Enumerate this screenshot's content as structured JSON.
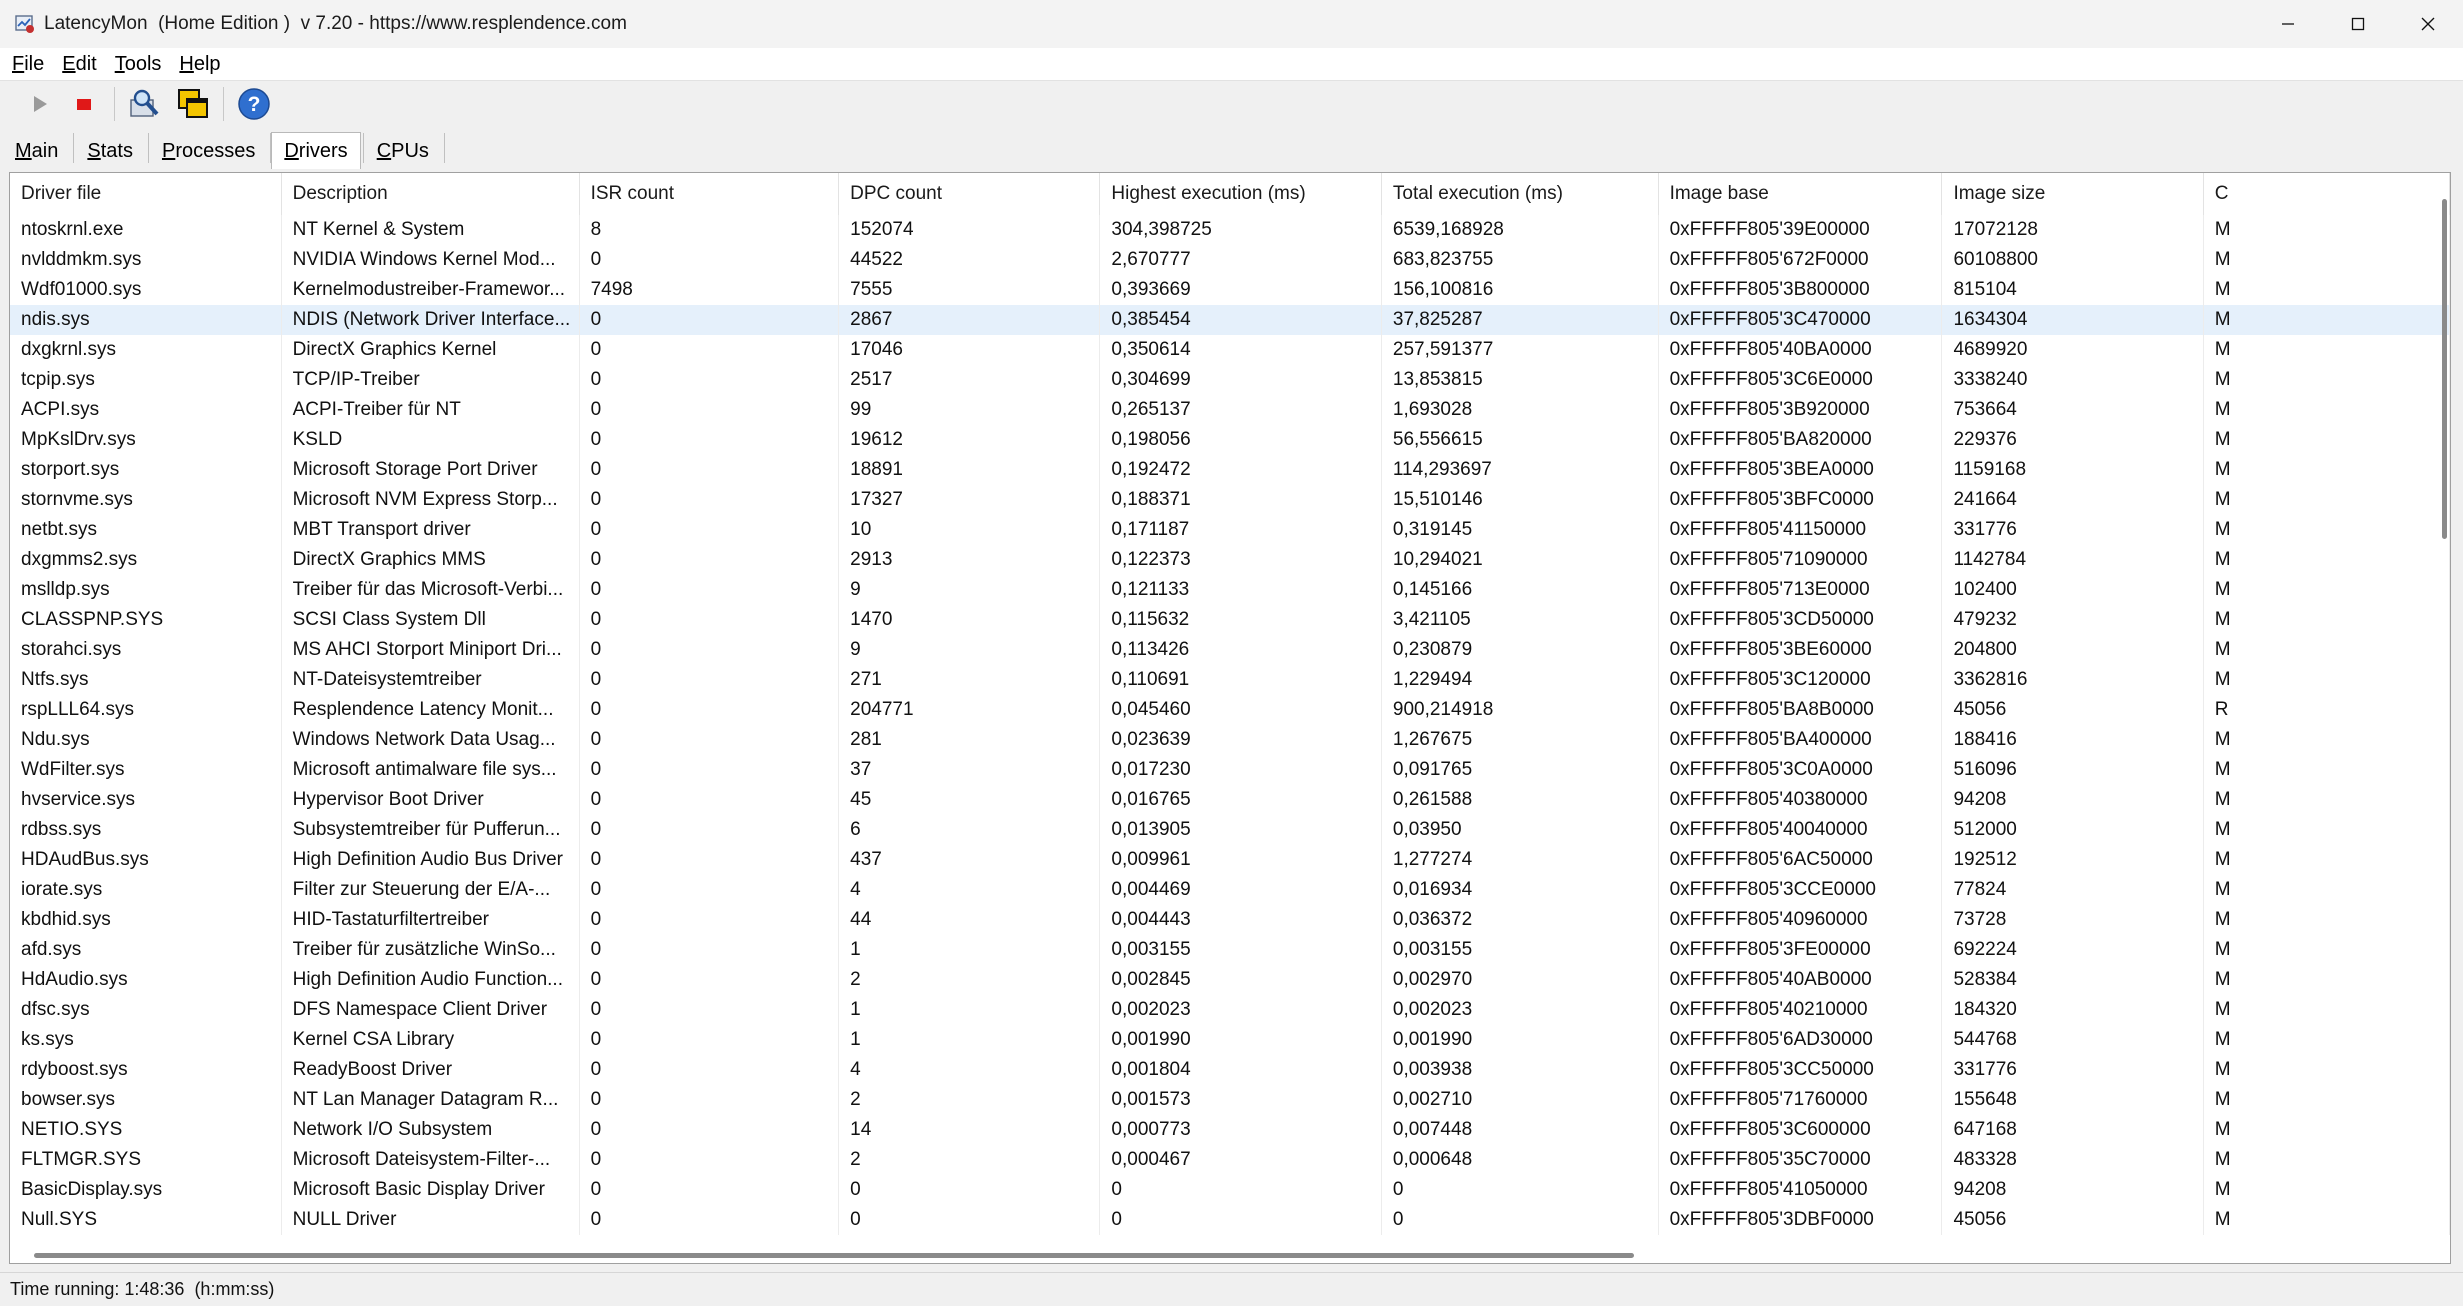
{
  "window": {
    "title": "LatencyMon  (Home Edition )  v 7.20 - https://www.resplendence.com"
  },
  "menu": [
    {
      "key": "F",
      "rest": "ile"
    },
    {
      "key": "E",
      "rest": "dit"
    },
    {
      "key": "T",
      "rest": "ools"
    },
    {
      "key": "H",
      "rest": "elp"
    }
  ],
  "toolbar": {
    "icons": [
      "play-icon",
      "stop-icon",
      "search-icon",
      "windows-icon",
      "help-icon"
    ]
  },
  "tabs": [
    {
      "key": "M",
      "rest": "ain",
      "active": false
    },
    {
      "key": "S",
      "rest": "tats",
      "active": false
    },
    {
      "key": "P",
      "rest": "rocesses",
      "active": false
    },
    {
      "key": "D",
      "rest": "rivers",
      "active": true
    },
    {
      "key": "C",
      "rest": "PUs",
      "active": false
    }
  ],
  "table": {
    "columns": [
      "Driver file",
      "Description",
      "ISR count",
      "DPC count",
      "Highest execution (ms)",
      "Total execution (ms)",
      "Image base",
      "Image size",
      "C"
    ],
    "selected_row": 3,
    "rows": [
      [
        "ntoskrnl.exe",
        "NT Kernel & System",
        "8",
        "152074",
        "304,398725",
        "6539,168928",
        "0xFFFFF805'39E00000",
        "17072128",
        "M"
      ],
      [
        "nvlddmkm.sys",
        "NVIDIA Windows Kernel Mod...",
        "0",
        "44522",
        "2,670777",
        "683,823755",
        "0xFFFFF805'672F0000",
        "60108800",
        "M"
      ],
      [
        "Wdf01000.sys",
        "Kernelmodustreiber-Framewor...",
        "7498",
        "7555",
        "0,393669",
        "156,100816",
        "0xFFFFF805'3B800000",
        "815104",
        "M"
      ],
      [
        "ndis.sys",
        "NDIS (Network Driver Interface...",
        "0",
        "2867",
        "0,385454",
        "37,825287",
        "0xFFFFF805'3C470000",
        "1634304",
        "M"
      ],
      [
        "dxgkrnl.sys",
        "DirectX Graphics Kernel",
        "0",
        "17046",
        "0,350614",
        "257,591377",
        "0xFFFFF805'40BA0000",
        "4689920",
        "M"
      ],
      [
        "tcpip.sys",
        "TCP/IP-Treiber",
        "0",
        "2517",
        "0,304699",
        "13,853815",
        "0xFFFFF805'3C6E0000",
        "3338240",
        "M"
      ],
      [
        "ACPI.sys",
        "ACPI-Treiber für NT",
        "0",
        "99",
        "0,265137",
        "1,693028",
        "0xFFFFF805'3B920000",
        "753664",
        "M"
      ],
      [
        "MpKslDrv.sys",
        "KSLD",
        "0",
        "19612",
        "0,198056",
        "56,556615",
        "0xFFFFF805'BA820000",
        "229376",
        "M"
      ],
      [
        "storport.sys",
        "Microsoft Storage Port Driver",
        "0",
        "18891",
        "0,192472",
        "114,293697",
        "0xFFFFF805'3BEA0000",
        "1159168",
        "M"
      ],
      [
        "stornvme.sys",
        "Microsoft NVM Express Storp...",
        "0",
        "17327",
        "0,188371",
        "15,510146",
        "0xFFFFF805'3BFC0000",
        "241664",
        "M"
      ],
      [
        "netbt.sys",
        "MBT Transport driver",
        "0",
        "10",
        "0,171187",
        "0,319145",
        "0xFFFFF805'41150000",
        "331776",
        "M"
      ],
      [
        "dxgmms2.sys",
        "DirectX Graphics MMS",
        "0",
        "2913",
        "0,122373",
        "10,294021",
        "0xFFFFF805'71090000",
        "1142784",
        "M"
      ],
      [
        "mslldp.sys",
        "Treiber für das Microsoft-Verbi...",
        "0",
        "9",
        "0,121133",
        "0,145166",
        "0xFFFFF805'713E0000",
        "102400",
        "M"
      ],
      [
        "CLASSPNP.SYS",
        "SCSI Class System Dll",
        "0",
        "1470",
        "0,115632",
        "3,421105",
        "0xFFFFF805'3CD50000",
        "479232",
        "M"
      ],
      [
        "storahci.sys",
        "MS AHCI Storport Miniport Dri...",
        "0",
        "9",
        "0,113426",
        "0,230879",
        "0xFFFFF805'3BE60000",
        "204800",
        "M"
      ],
      [
        "Ntfs.sys",
        "NT-Dateisystemtreiber",
        "0",
        "271",
        "0,110691",
        "1,229494",
        "0xFFFFF805'3C120000",
        "3362816",
        "M"
      ],
      [
        "rspLLL64.sys",
        "Resplendence Latency Monit...",
        "0",
        "204771",
        "0,045460",
        "900,214918",
        "0xFFFFF805'BA8B0000",
        "45056",
        "R"
      ],
      [
        "Ndu.sys",
        "Windows Network Data Usag...",
        "0",
        "281",
        "0,023639",
        "1,267675",
        "0xFFFFF805'BA400000",
        "188416",
        "M"
      ],
      [
        "WdFilter.sys",
        "Microsoft antimalware file sys...",
        "0",
        "37",
        "0,017230",
        "0,091765",
        "0xFFFFF805'3C0A0000",
        "516096",
        "M"
      ],
      [
        "hvservice.sys",
        "Hypervisor Boot Driver",
        "0",
        "45",
        "0,016765",
        "0,261588",
        "0xFFFFF805'40380000",
        "94208",
        "M"
      ],
      [
        "rdbss.sys",
        "Subsystemtreiber für Pufferun...",
        "0",
        "6",
        "0,013905",
        "0,03950",
        "0xFFFFF805'40040000",
        "512000",
        "M"
      ],
      [
        "HDAudBus.sys",
        "High Definition Audio Bus Driver",
        "0",
        "437",
        "0,009961",
        "1,277274",
        "0xFFFFF805'6AC50000",
        "192512",
        "M"
      ],
      [
        "iorate.sys",
        "Filter zur Steuerung der E/A-...",
        "0",
        "4",
        "0,004469",
        "0,016934",
        "0xFFFFF805'3CCE0000",
        "77824",
        "M"
      ],
      [
        "kbdhid.sys",
        "HID-Tastaturfiltertreiber",
        "0",
        "44",
        "0,004443",
        "0,036372",
        "0xFFFFF805'40960000",
        "73728",
        "M"
      ],
      [
        "afd.sys",
        "Treiber für zusätzliche WinSo...",
        "0",
        "1",
        "0,003155",
        "0,003155",
        "0xFFFFF805'3FE00000",
        "692224",
        "M"
      ],
      [
        "HdAudio.sys",
        "High Definition Audio Function...",
        "0",
        "2",
        "0,002845",
        "0,002970",
        "0xFFFFF805'40AB0000",
        "528384",
        "M"
      ],
      [
        "dfsc.sys",
        "DFS Namespace Client Driver",
        "0",
        "1",
        "0,002023",
        "0,002023",
        "0xFFFFF805'40210000",
        "184320",
        "M"
      ],
      [
        "ks.sys",
        "Kernel CSA Library",
        "0",
        "1",
        "0,001990",
        "0,001990",
        "0xFFFFF805'6AD30000",
        "544768",
        "M"
      ],
      [
        "rdyboost.sys",
        "ReadyBoost Driver",
        "0",
        "4",
        "0,001804",
        "0,003938",
        "0xFFFFF805'3CC50000",
        "331776",
        "M"
      ],
      [
        "bowser.sys",
        "NT Lan Manager Datagram R...",
        "0",
        "2",
        "0,001573",
        "0,002710",
        "0xFFFFF805'71760000",
        "155648",
        "M"
      ],
      [
        "NETIO.SYS",
        "Network I/O Subsystem",
        "0",
        "14",
        "0,000773",
        "0,007448",
        "0xFFFFF805'3C600000",
        "647168",
        "M"
      ],
      [
        "FLTMGR.SYS",
        "Microsoft Dateisystem-Filter-...",
        "0",
        "2",
        "0,000467",
        "0,000648",
        "0xFFFFF805'35C70000",
        "483328",
        "M"
      ],
      [
        "BasicDisplay.sys",
        "Microsoft Basic Display Driver",
        "0",
        "0",
        "0",
        "0",
        "0xFFFFF805'41050000",
        "94208",
        "M"
      ],
      [
        "Null.SYS",
        "NULL Driver",
        "0",
        "0",
        "0",
        "0",
        "0xFFFFF805'3DBF0000",
        "45056",
        "M"
      ]
    ]
  },
  "status": {
    "text": "Time running: 1:48:36  (h:mm:ss)"
  }
}
